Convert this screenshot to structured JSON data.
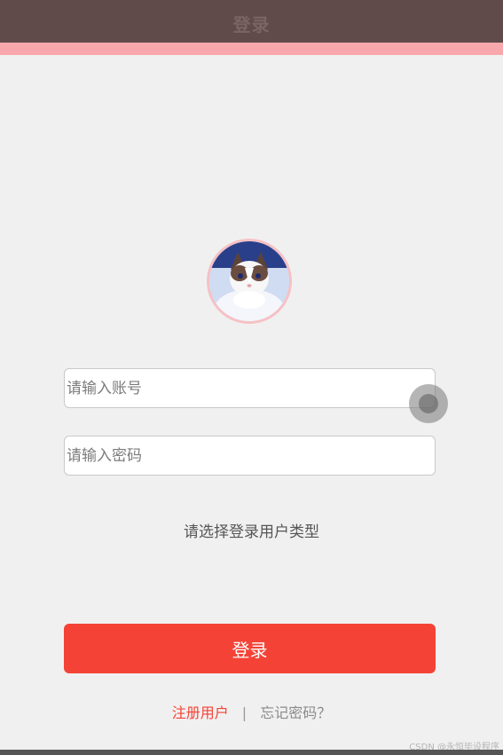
{
  "header": {
    "title": "登录"
  },
  "login_form": {
    "account_placeholder": "请输入账号",
    "password_placeholder": "请输入密码",
    "user_type_prompt": "请选择登录用户类型",
    "login_button_label": "登录"
  },
  "links": {
    "register_label": "注册用户",
    "separator": "|",
    "forgot_label": "忘记密码？"
  },
  "watermark": "CSDN @永恒毕设程序",
  "colors": {
    "header_bg": "#604b4a",
    "accent_band": "#f8a8ad",
    "primary_button": "#f44336",
    "page_bg": "#f1f0f0"
  },
  "icons": {
    "avatar": "cat-avatar-image"
  }
}
